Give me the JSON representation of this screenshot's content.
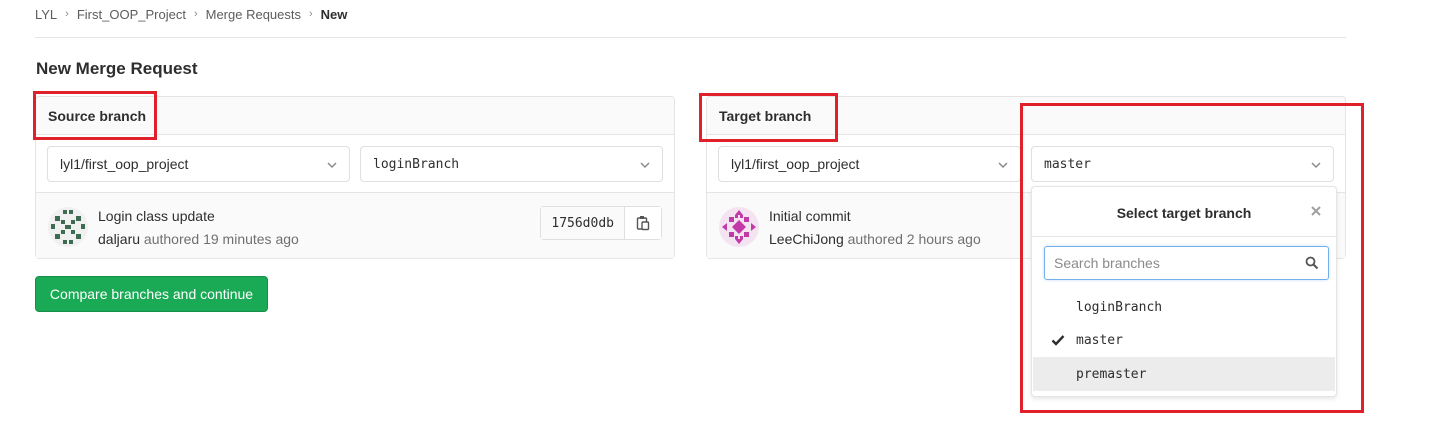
{
  "breadcrumb": {
    "items": [
      "LYL",
      "First_OOP_Project",
      "Merge Requests",
      "New"
    ],
    "separator": "›"
  },
  "page": {
    "title": "New Merge Request"
  },
  "source": {
    "label": "Source branch",
    "project": "lyl1/first_oop_project",
    "branch": "loginBranch",
    "commit": {
      "title": "Login class update",
      "author": "daljaru",
      "meta": " authored 19 minutes ago",
      "sha": "1756d0db"
    }
  },
  "target": {
    "label": "Target branch",
    "project": "lyl1/first_oop_project",
    "branch": "master",
    "commit": {
      "title": "Initial commit",
      "author": "LeeChiJong",
      "meta": " authored 2 hours ago"
    }
  },
  "dropdown": {
    "title": "Select target branch",
    "search_placeholder": "Search branches",
    "items": [
      "loginBranch",
      "master",
      "premaster"
    ],
    "selected": "master",
    "hovered": "premaster"
  },
  "actions": {
    "compare_label": "Compare branches and continue"
  },
  "colors": {
    "accent_green": "#1aaa55",
    "highlight_red": "#e0202a",
    "focus_blue": "#73afea"
  },
  "icons": {
    "chevron": "chevron-down-icon",
    "copy": "clipboard-icon",
    "close": "close-icon",
    "search": "search-icon",
    "check": "check-icon"
  }
}
